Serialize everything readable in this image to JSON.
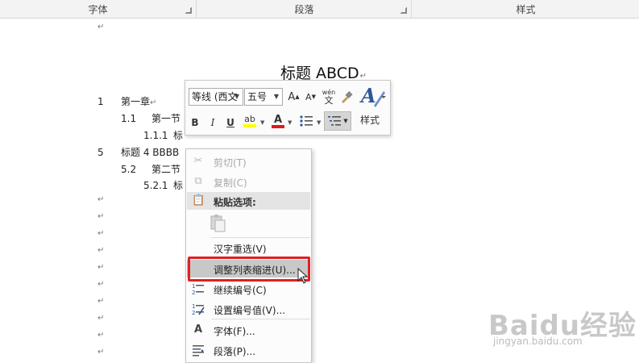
{
  "ribbon": {
    "groups": [
      "字体",
      "段落",
      "样式"
    ]
  },
  "document": {
    "title": "标题 ABCD",
    "paragraph_mark": "↵",
    "lines": [
      {
        "num": "1",
        "text": "第一章"
      },
      {
        "num": "1.1",
        "text": "第一节"
      },
      {
        "num": "1.1.1",
        "text": "标"
      },
      {
        "num": "5",
        "text": "标题 4 BBBB"
      },
      {
        "num": "5.2",
        "text": "第二节"
      },
      {
        "num": "5.2.1",
        "text": "标"
      }
    ]
  },
  "mini_toolbar": {
    "font_name": "等线 (西文",
    "font_size": "五号",
    "grow_font": "A",
    "shrink_font": "A",
    "phonetic_top": "wén",
    "phonetic_bottom": "文",
    "bold": "B",
    "italic": "I",
    "underline": "U",
    "highlight": "ab",
    "font_color": "A",
    "styles_label": "样式",
    "highlight_color": "#ffff00",
    "font_color_value": "#e21818"
  },
  "context_menu": {
    "items": [
      {
        "label": "剪切(T)",
        "icon": "scissors-icon",
        "disabled": true
      },
      {
        "label": "复制(C)",
        "icon": "copy-icon",
        "disabled": true
      },
      {
        "label": "粘贴选项:",
        "icon": "paste-icon",
        "header": true
      },
      {
        "label": "汉字重选(V)",
        "icon": ""
      },
      {
        "label": "调整列表缩进(U)...",
        "icon": "",
        "hover": true
      },
      {
        "label": "继续编号(C)",
        "icon": "continue-numbering-icon"
      },
      {
        "label": "设置编号值(V)...",
        "icon": "set-numbering-value-icon"
      },
      {
        "label": "字体(F)...",
        "icon": "font-icon"
      },
      {
        "label": "段落(P)...",
        "icon": "paragraph-icon"
      }
    ],
    "highlight_color": "#e02020"
  },
  "watermark": {
    "main": "Baidu经验",
    "sub": "jingyan.baidu.com"
  }
}
